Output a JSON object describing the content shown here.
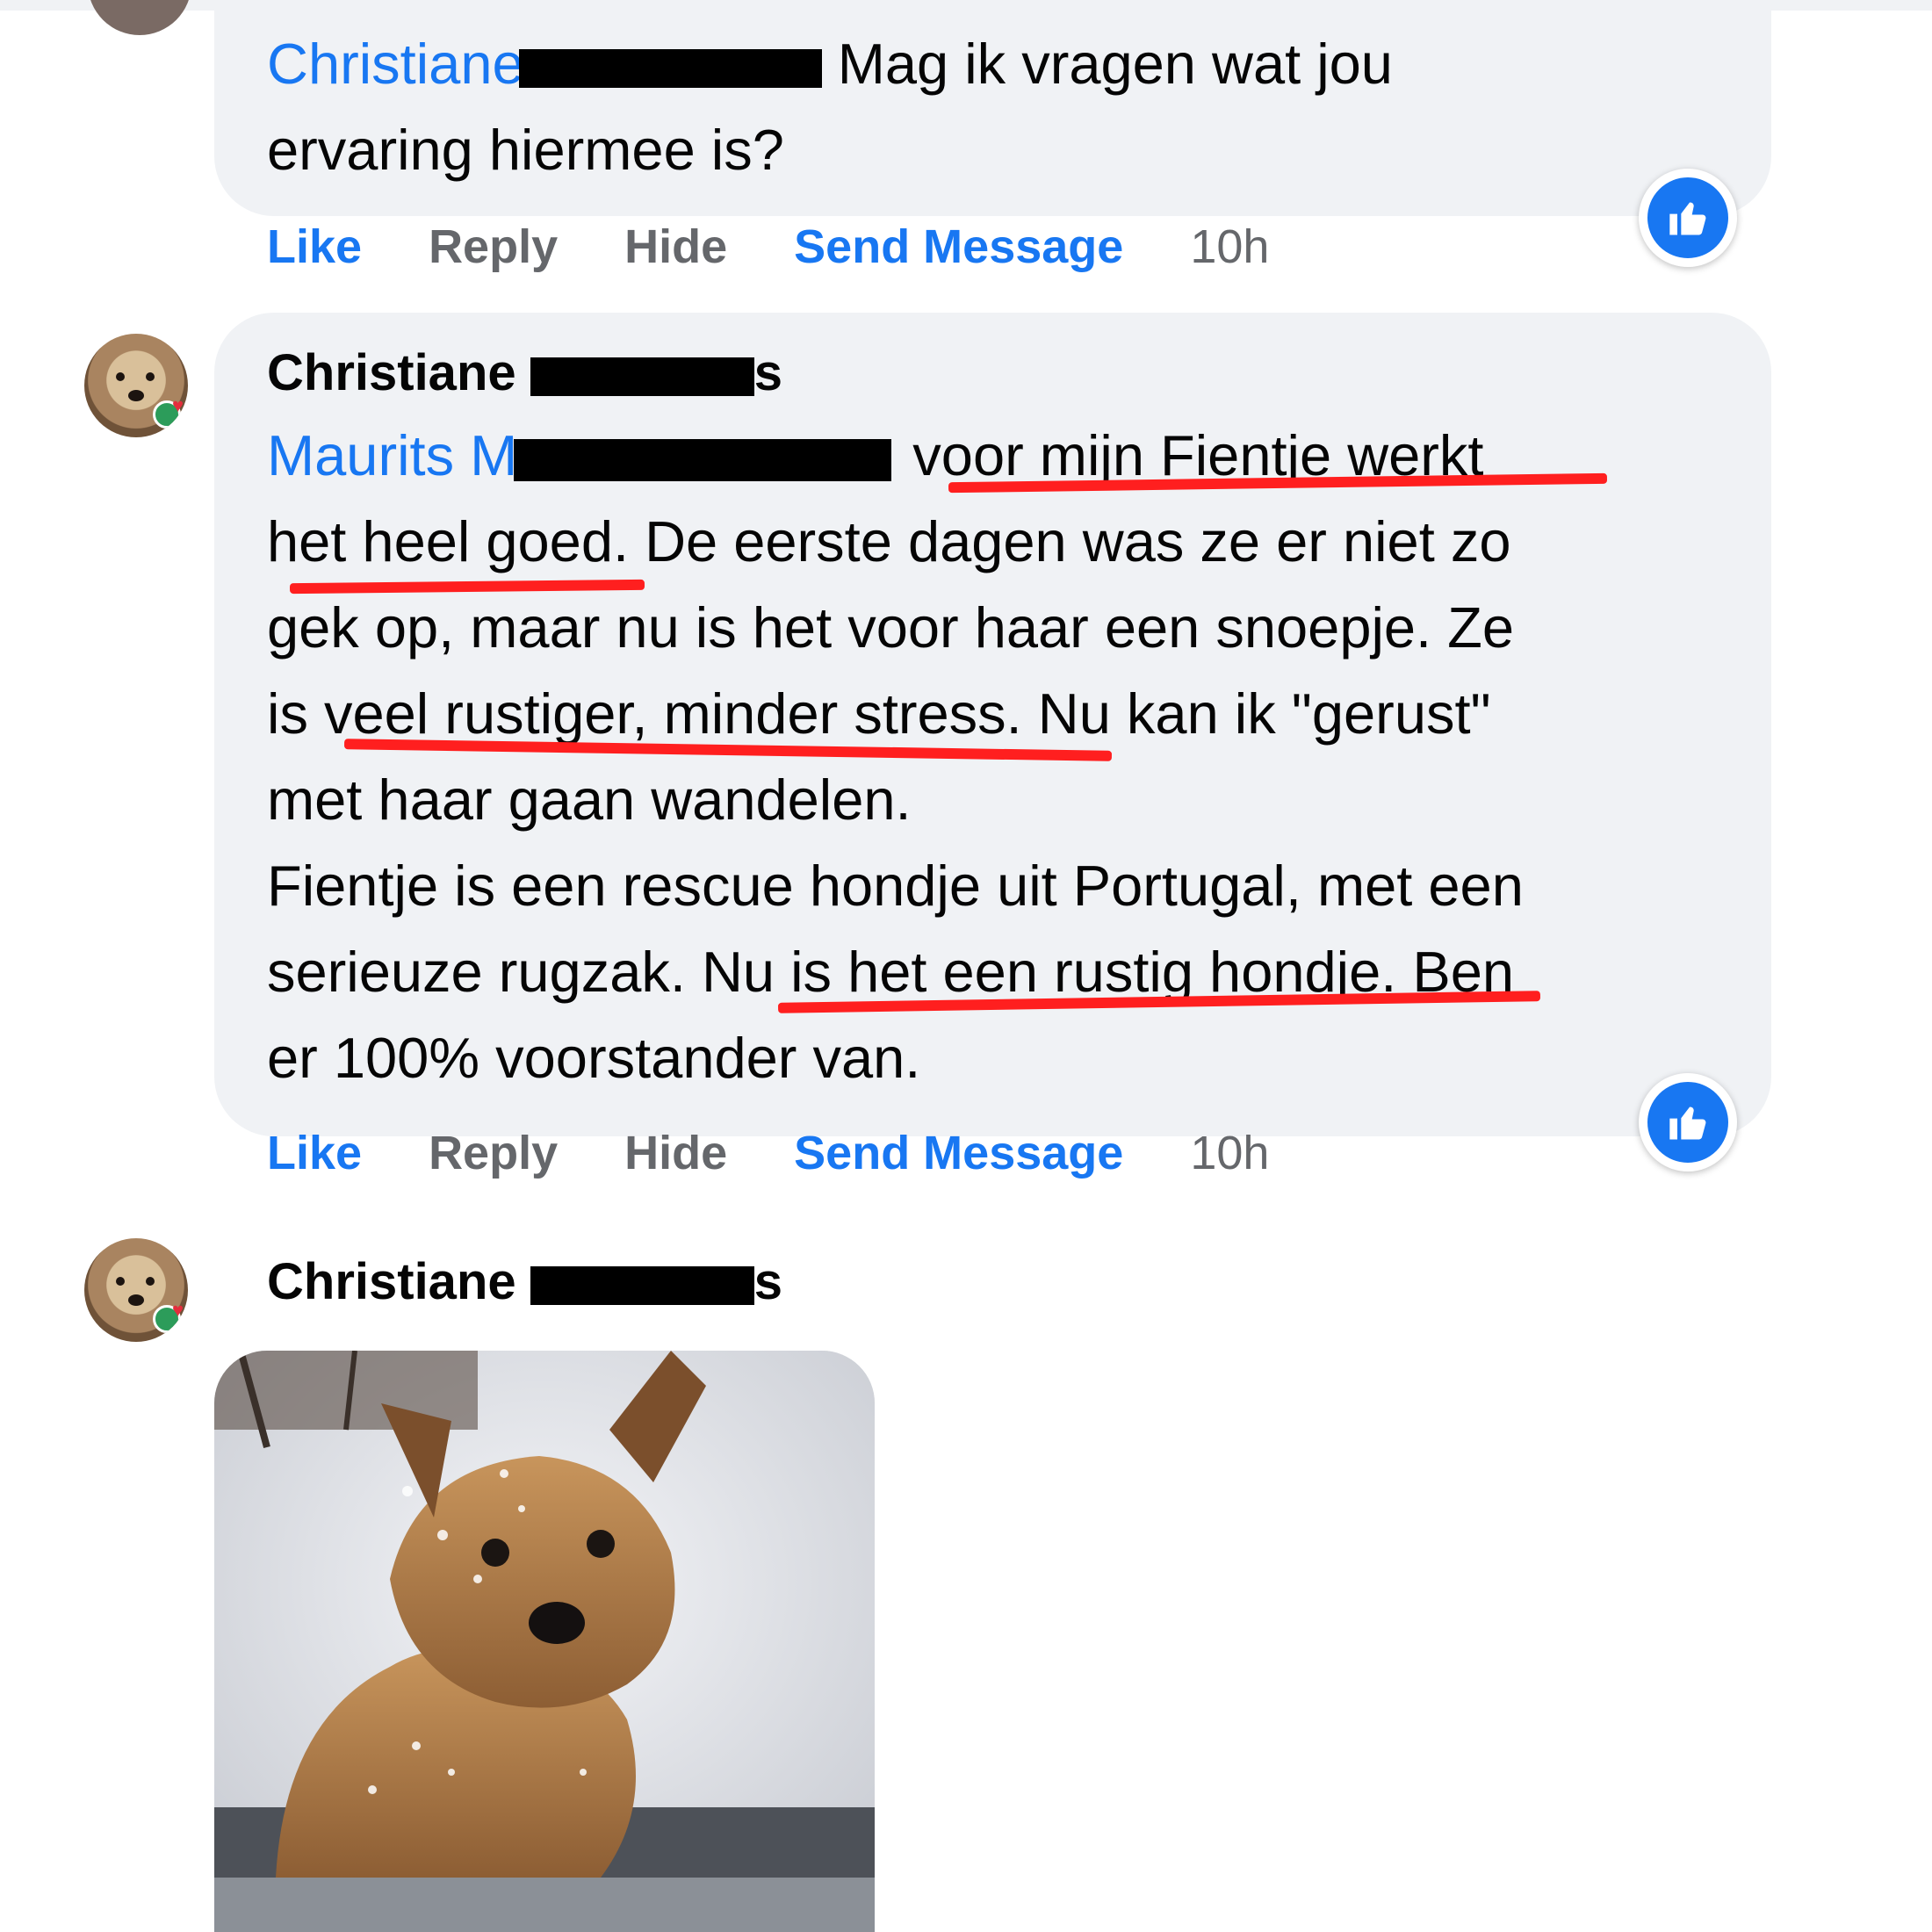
{
  "comment1": {
    "mention": "Christiane",
    "text_line1": " Mag ik vragen wat jou",
    "text_line2": "ervaring hiermee is?",
    "actions": {
      "like": "Like",
      "reply": "Reply",
      "hide": "Hide",
      "send_message": "Send Message",
      "time": "10h"
    }
  },
  "comment2": {
    "author_first": "Christiane",
    "author_last_tail": "s",
    "mention": "Maurits M",
    "lines": [
      "voor mijn Fientje werkt",
      "het heel goed. De eerste dagen was ze er niet zo",
      "gek op, maar nu is het voor haar een snoepje. Ze",
      "is veel rustiger, minder stress. Nu kan ik \"gerust\"",
      "met haar gaan wandelen.",
      "Fientje is een rescue hondje uit Portugal, met een",
      "serieuze rugzak. Nu is het een rustig hondje. Ben",
      "er 100% voorstander van."
    ],
    "actions": {
      "like": "Like",
      "reply": "Reply",
      "hide": "Hide",
      "send_message": "Send Message",
      "time": "10h"
    }
  },
  "comment3": {
    "author_first": "Christiane",
    "author_last_tail": "s"
  },
  "colors": {
    "link": "#1877f2",
    "bubble": "#f0f2f5",
    "underline": "#ff1f1f",
    "muted": "#65676b"
  },
  "icons": {
    "reaction": "thumbs-up-icon"
  }
}
